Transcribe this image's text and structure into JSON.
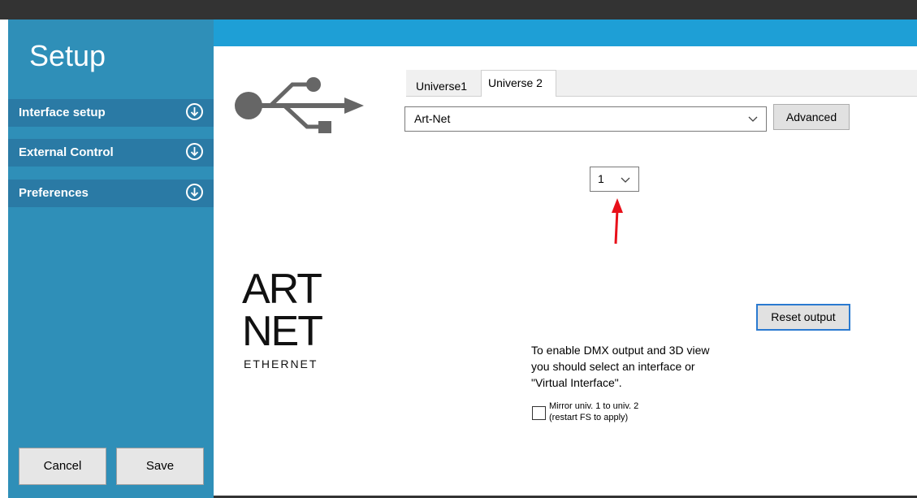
{
  "sidebar": {
    "title": "Setup",
    "items": [
      {
        "label": "Interface setup",
        "icon": "arrow-circle-down-icon"
      },
      {
        "label": "External Control",
        "icon": "arrow-circle-down-icon"
      },
      {
        "label": "Preferences",
        "icon": "arrow-circle-down-icon"
      }
    ],
    "cancel_label": "Cancel",
    "save_label": "Save"
  },
  "tabs": [
    {
      "label": "Universe1",
      "active": false
    },
    {
      "label": "Universe 2",
      "active": true
    }
  ],
  "interface_select": {
    "value": "Art-Net"
  },
  "advanced_label": "Advanced",
  "universe_select": {
    "value": "1"
  },
  "logo": {
    "text_line1": "ART",
    "text_line2": "NET",
    "text_line3": "ETHERNET"
  },
  "reset_label": "Reset output",
  "info_text": {
    "line1": "To enable DMX output and 3D view",
    "line2": "you should select an interface or",
    "line3": "\"Virtual Interface\"."
  },
  "mirror": {
    "line1": "Mirror univ. 1 to univ. 2",
    "line2": "(restart FS to apply)",
    "checked": false
  },
  "colors": {
    "sidebar_bg": "#2f8fb8",
    "sidebar_item_bg": "#2a7aa5",
    "header_strip": "#1e9fd6",
    "annotation_arrow": "#e8101a"
  }
}
